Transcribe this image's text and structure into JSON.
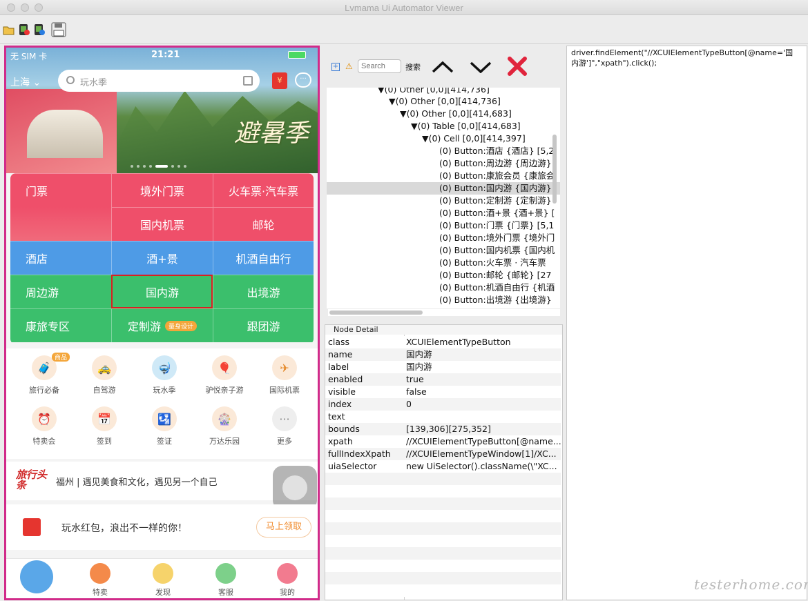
{
  "window": {
    "title": "Lvmama Ui Automator Viewer"
  },
  "toolbar": {
    "icons": [
      "open-icon",
      "screenshot-icon",
      "screenshot2-icon",
      "save-icon"
    ]
  },
  "phone": {
    "status": {
      "carrier": "无 SIM 卡",
      "time": "21:21"
    },
    "city": "上海",
    "search_placeholder": "玩水季",
    "redbag": "¥",
    "msg": "···",
    "slogan": "避暑季",
    "grid": [
      [
        "门票",
        "境外门票",
        "火车票·汽车票"
      ],
      [
        "",
        "国内机票",
        "邮轮"
      ],
      [
        "酒店",
        "酒+景",
        "机酒自由行"
      ],
      [
        "周边游",
        "国内游",
        "出境游"
      ],
      [
        "康旅专区",
        "定制游",
        "跟团游"
      ]
    ],
    "grid_tag": "量身设计",
    "icons": [
      "旅行必备",
      "自驾游",
      "玩水季",
      "驴悦亲子游",
      "国际机票",
      "特卖会",
      "签到",
      "签证",
      "万达乐园",
      "更多"
    ],
    "icons_badge": "商品",
    "news_logo": "旅行头条",
    "news_text": "福州 | 遇见美食和文化，遇见另一个自己",
    "promo_text": "玩水红包，浪出不一样的你！",
    "promo_button": "马上领取",
    "tabs": [
      "",
      "特卖",
      "发现",
      "客服",
      "我的"
    ]
  },
  "tree_search": {
    "placeholder": "Search",
    "label": "搜索"
  },
  "tree": [
    "▼(0) Other [0,0][414,736]",
    "▼(0) Other [0,0][414,736]",
    "▼(0) Other [0,0][414,683]",
    "▼(0) Table [0,0][414,683]",
    "▼(0) Cell [0,0][414,397]",
    "(0) Button:酒店 {酒店} [5,2",
    "(0) Button:周边游 {周边游}",
    "(0) Button:康旅会员 {康旅会",
    "(0) Button:国内游 {国内游}",
    "(0) Button:定制游 {定制游}",
    "(0) Button:酒+景 {酒+景} [",
    "(0) Button:门票 {门票} [5,1",
    "(0) Button:境外门票 {境外门",
    "(0) Button:国内机票 {国内机",
    "(0) Button:火车票 · 汽车票",
    "(0) Button:邮轮 {邮轮} [27",
    "(0) Button:机酒自由行 {机酒",
    "(0) Button:出境游 {出境游}"
  ],
  "detail": {
    "header": "Node Detail",
    "rows": [
      {
        "k": "class",
        "v": "XCUIElementTypeButton"
      },
      {
        "k": "name",
        "v": "国内游"
      },
      {
        "k": "label",
        "v": "国内游"
      },
      {
        "k": "enabled",
        "v": "true"
      },
      {
        "k": "visible",
        "v": "false"
      },
      {
        "k": "index",
        "v": "0"
      },
      {
        "k": "text",
        "v": ""
      },
      {
        "k": "bounds",
        "v": "[139,306][275,352]"
      },
      {
        "k": "xpath",
        "v": "//XCUIElementTypeButton[@name..."
      },
      {
        "k": "fullIndexXpath",
        "v": "//XCUIElementTypeWindow[1]/XC..."
      },
      {
        "k": "uiaSelector",
        "v": "new UiSelector().className(\\\"XC..."
      }
    ]
  },
  "code": "driver.findElement(\"//XCUIElementTypeButton[@name='国内游']\",\"xpath\").click();",
  "watermark": "testerhome.com",
  "colors": {
    "phone_border": "#d12b8a",
    "ticket": "#ef4f6a",
    "hotel": "#4e9be6",
    "tour": "#3bbf6c",
    "close": "#e0243c"
  }
}
